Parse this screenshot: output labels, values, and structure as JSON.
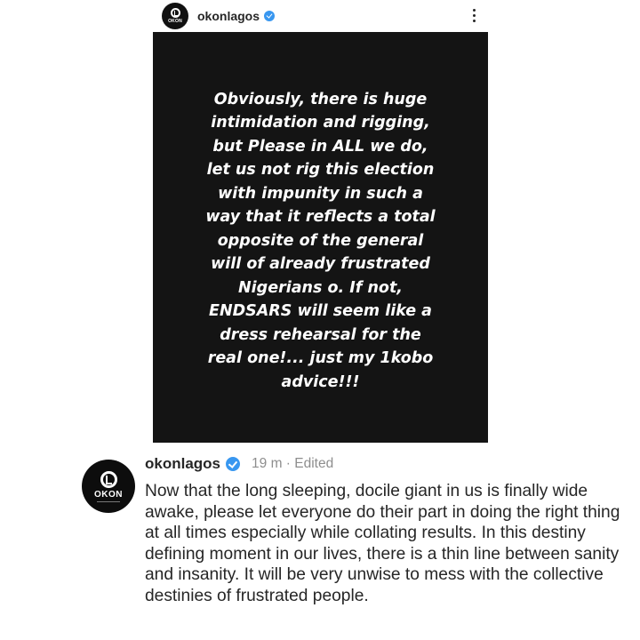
{
  "post_header": {
    "avatar_logo_text": "OKON",
    "username": "okonlagos",
    "verified_icon": "verified-badge-icon",
    "more_icon": "more-options-icon"
  },
  "story": {
    "text": "Obviously, there is huge intimidation and rigging, but Please in ALL we do, let us not rig this election with impunity in such a way that it reflects a total opposite of the general will of already frustrated Nigerians o. If not, ENDSARS will seem like a dress rehearsal for the real one!... just my 1kobo advice!!!",
    "background_color": "#141414"
  },
  "caption": {
    "avatar_logo_text": "OKON",
    "username": "okonlagos",
    "time": "19 m · Edited",
    "text": "Now that the long sleeping, docile giant in us is finally wide awake, please let everyone do their part in doing the right thing at all times especially while collating results. In this destiny defining moment in our lives, there is a thin line between sanity and insanity. It will be very unwise to mess with the collective destinies of frustrated people."
  },
  "colors": {
    "verified_blue": "#3897f0",
    "muted_text": "#8e8e8e"
  }
}
